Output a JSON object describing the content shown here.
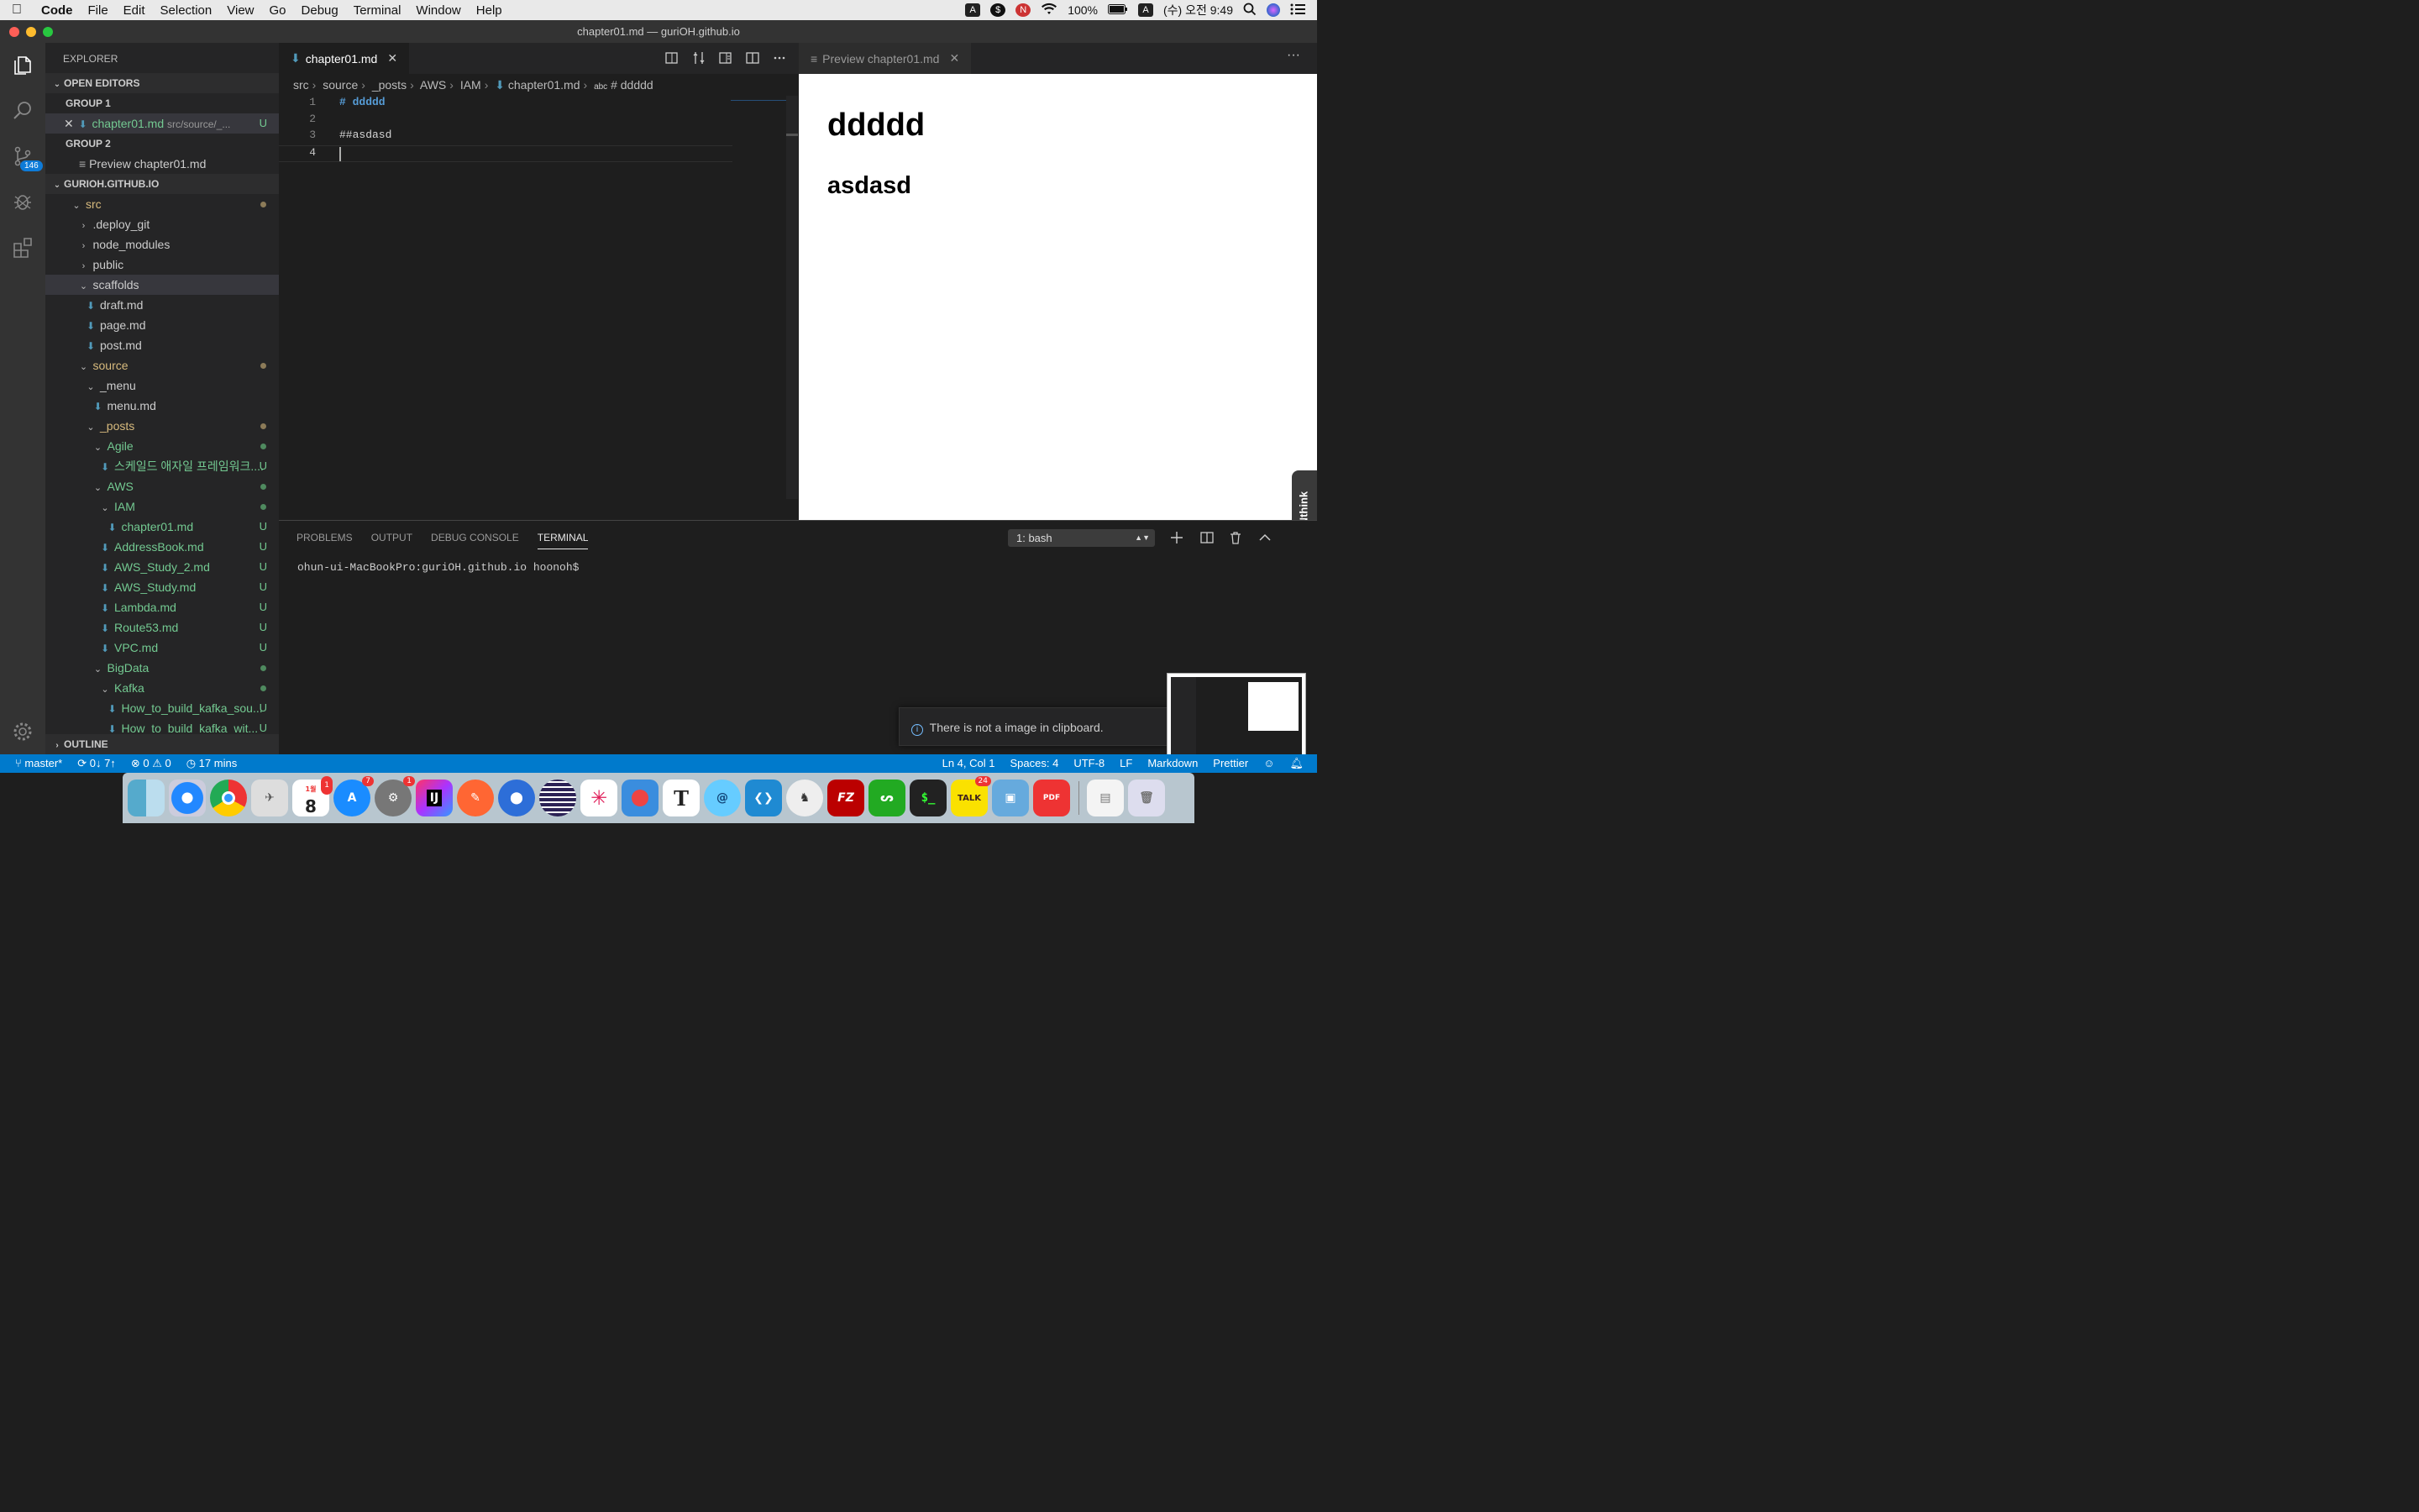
{
  "menubar": {
    "app": "Code",
    "items": [
      "File",
      "Edit",
      "Selection",
      "View",
      "Go",
      "Debug",
      "Terminal",
      "Window",
      "Help"
    ],
    "battery": "100%",
    "datetime": "(수) 오전 9:49"
  },
  "window": {
    "title": "chapter01.md — guriOH.github.io"
  },
  "activity": {
    "scm_badge": "146"
  },
  "explorer": {
    "title": "EXPLORER",
    "open_editors_label": "OPEN EDITORS",
    "group1": "GROUP 1",
    "group1_file": "chapter01.md",
    "group1_path": "src/source/_...",
    "group1_status": "U",
    "group2": "GROUP 2",
    "group2_file": "Preview chapter01.md",
    "workspace_label": "GURIOH.GITHUB.IO",
    "tree": [
      {
        "label": "src",
        "indent": 0,
        "type": "folder-open",
        "color": "olive",
        "dot": "#8c7b58"
      },
      {
        "label": ".deploy_git",
        "indent": 1,
        "type": "folder",
        "color": "normal"
      },
      {
        "label": "node_modules",
        "indent": 1,
        "type": "folder",
        "color": "normal"
      },
      {
        "label": "public",
        "indent": 1,
        "type": "folder",
        "color": "normal"
      },
      {
        "label": "scaffolds",
        "indent": 1,
        "type": "folder-open",
        "color": "normal",
        "selected": true
      },
      {
        "label": "draft.md",
        "indent": 2,
        "type": "md",
        "color": "normal"
      },
      {
        "label": "page.md",
        "indent": 2,
        "type": "md",
        "color": "normal"
      },
      {
        "label": "post.md",
        "indent": 2,
        "type": "md",
        "color": "normal"
      },
      {
        "label": "source",
        "indent": 1,
        "type": "folder-open",
        "color": "olive",
        "dot": "#8c7b58"
      },
      {
        "label": "_menu",
        "indent": 2,
        "type": "folder-open",
        "color": "normal"
      },
      {
        "label": "menu.md",
        "indent": 3,
        "type": "md",
        "color": "normal"
      },
      {
        "label": "_posts",
        "indent": 2,
        "type": "folder-open",
        "color": "olive",
        "dot": "#8c7b58"
      },
      {
        "label": "Agile",
        "indent": 3,
        "type": "folder-open",
        "color": "green",
        "dot": "#4f8a5f"
      },
      {
        "label": "스케일드 애자일 프레임워크....",
        "indent": 4,
        "type": "md",
        "color": "green",
        "status": "U"
      },
      {
        "label": "AWS",
        "indent": 3,
        "type": "folder-open",
        "color": "green",
        "dot": "#4f8a5f"
      },
      {
        "label": "IAM",
        "indent": 4,
        "type": "folder-open",
        "color": "green",
        "dot": "#4f8a5f"
      },
      {
        "label": "chapter01.md",
        "indent": 5,
        "type": "md",
        "color": "green",
        "status": "U"
      },
      {
        "label": "AddressBook.md",
        "indent": 4,
        "type": "md",
        "color": "green",
        "status": "U"
      },
      {
        "label": "AWS_Study_2.md",
        "indent": 4,
        "type": "md",
        "color": "green",
        "status": "U"
      },
      {
        "label": "AWS_Study.md",
        "indent": 4,
        "type": "md",
        "color": "green",
        "status": "U"
      },
      {
        "label": "Lambda.md",
        "indent": 4,
        "type": "md",
        "color": "green",
        "status": "U"
      },
      {
        "label": "Route53.md",
        "indent": 4,
        "type": "md",
        "color": "green",
        "status": "U"
      },
      {
        "label": "VPC.md",
        "indent": 4,
        "type": "md",
        "color": "green",
        "status": "U"
      },
      {
        "label": "BigData",
        "indent": 3,
        "type": "folder-open",
        "color": "green",
        "dot": "#4f8a5f"
      },
      {
        "label": "Kafka",
        "indent": 4,
        "type": "folder-open",
        "color": "green",
        "dot": "#4f8a5f"
      },
      {
        "label": "How_to_build_kafka_sou...",
        "indent": 5,
        "type": "md",
        "color": "green",
        "status": "U"
      },
      {
        "label": "How_to_build_kafka_wit...",
        "indent": 5,
        "type": "md",
        "color": "green",
        "status": "U"
      }
    ],
    "outline_label": "OUTLINE"
  },
  "editor": {
    "tab_label": "chapter01.md",
    "breadcrumb": [
      "src",
      "source",
      "_posts",
      "AWS",
      "IAM",
      "chapter01.md",
      "# ddddd"
    ],
    "breadcrumb_abc": "abc",
    "lines": [
      {
        "n": "1",
        "text": "# ddddd"
      },
      {
        "n": "2",
        "text": ""
      },
      {
        "n": "3",
        "text": "##asdasd"
      },
      {
        "n": "4",
        "text": ""
      }
    ]
  },
  "preview": {
    "tab_label": "Preview chapter01.md",
    "h1": "ddddd",
    "h2": "asdasd"
  },
  "panel": {
    "tabs": [
      "PROBLEMS",
      "OUTPUT",
      "DEBUG CONSOLE",
      "TERMINAL"
    ],
    "active_tab": "TERMINAL",
    "shell_select": "1: bash",
    "terminal_line": "ohun-ui-MacBookPro:guriOH.github.io hoonoh$"
  },
  "notification": {
    "text": "There is not a image in clipboard."
  },
  "devonthink": "DEVONthink",
  "status": {
    "branch": "master*",
    "sync": "0↓ 7↑",
    "errors": "0",
    "warnings": "0",
    "time": "17 mins",
    "position": "Ln 4, Col 1",
    "spaces": "Spaces: 4",
    "encoding": "UTF-8",
    "eol": "LF",
    "language": "Markdown",
    "formatter": "Prettier"
  },
  "dock": {
    "calendar_day": "8",
    "calendar_month": "1월",
    "appstore_badge": "7",
    "prefs_badge": "1",
    "calendar_badge": "1",
    "talk_badge": "24",
    "talk_label": "TALK",
    "ij_label": "IJ",
    "t_label": "T",
    "pdf_label": "PDF"
  }
}
